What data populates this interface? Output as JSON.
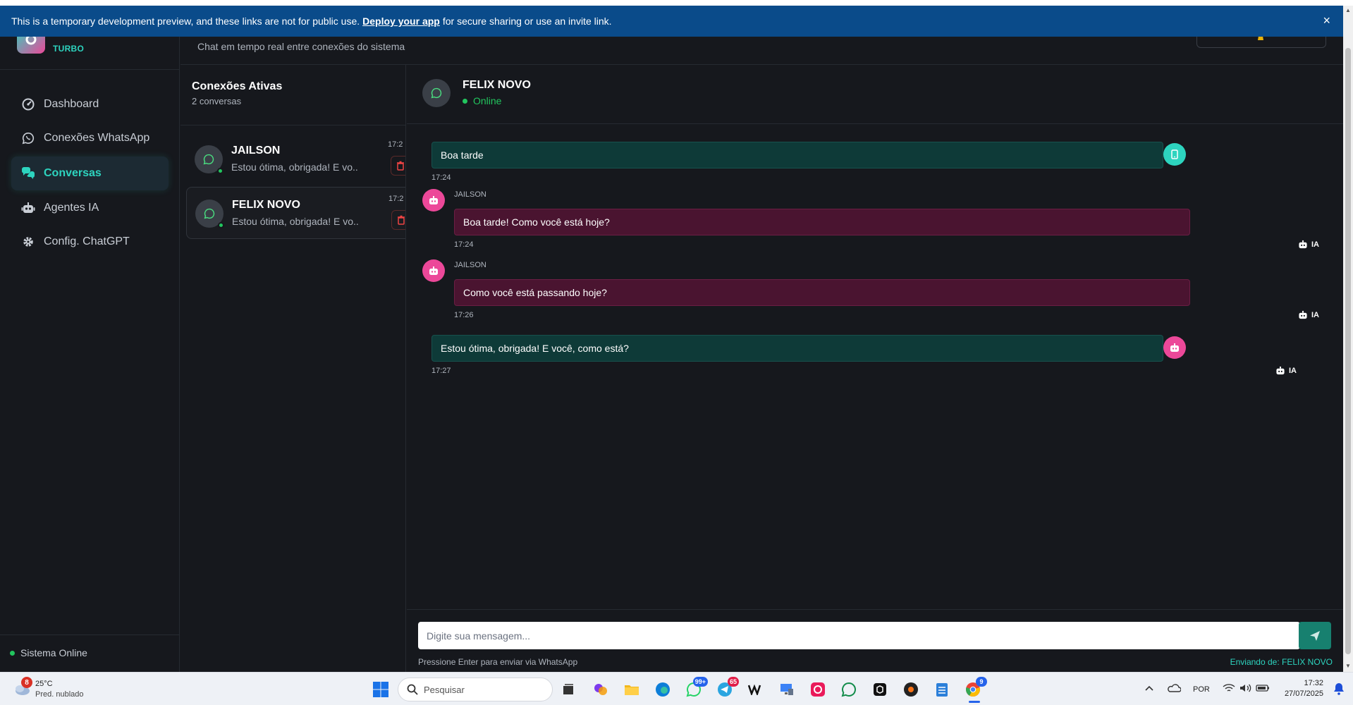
{
  "banner": {
    "text_before": "This is a temporary development preview, and these links are not for public use.",
    "link": "Deploy your app",
    "text_after": "for secure sharing or use an invite link.",
    "close": "×"
  },
  "brand": {
    "subtitle": "TURBO"
  },
  "nav": {
    "items": [
      {
        "label": "Dashboard",
        "icon": "dashboard-icon"
      },
      {
        "label": "Conexões WhatsApp",
        "icon": "whatsapp-icon"
      },
      {
        "label": "Conversas",
        "icon": "chat-icon",
        "active": true
      },
      {
        "label": "Agentes IA",
        "icon": "robot-icon"
      },
      {
        "label": "Config. ChatGPT",
        "icon": "gear-icon"
      }
    ]
  },
  "system_status": "Sistema Online",
  "header": {
    "subtitle": "Chat em tempo real entre conexões do sistema"
  },
  "conversations": {
    "title": "Conexões Ativas",
    "count": "2 conversas",
    "items": [
      {
        "name": "JAILSON",
        "preview": "Estou ótima, obrigada! E vo...",
        "time": "17:2"
      },
      {
        "name": "FELIX NOVO",
        "preview": "Estou ótima, obrigada! E vo...",
        "time": "17:2",
        "selected": true
      }
    ]
  },
  "chat": {
    "contact_name": "FELIX NOVO",
    "status": "Online",
    "messages": [
      {
        "direction": "out",
        "text": "Boa tarde",
        "time": "17:24"
      },
      {
        "direction": "in",
        "sender": "JAILSON",
        "text": "Boa tarde! Como você está hoje?",
        "time": "17:24",
        "badge": "IA"
      },
      {
        "direction": "in",
        "sender": "JAILSON",
        "text": "Como você está passando hoje?",
        "time": "17:26",
        "badge": "IA"
      },
      {
        "direction": "out",
        "text": "Estou ótima, obrigada! E você, como está?",
        "time": "17:27",
        "badge": "IA"
      }
    ],
    "input_placeholder": "Digite sua mensagem...",
    "hint": "Pressione Enter para enviar via WhatsApp",
    "sending_from": "Enviando de: FELIX NOVO"
  },
  "taskbar": {
    "weather_temp": "25°C",
    "weather_desc": "Pred. nublado",
    "weather_badge": "8",
    "search_placeholder": "Pesquisar",
    "whatsapp_badge": "99+",
    "telegram_badge": "65",
    "chrome_badge": "9",
    "language": "POR",
    "time": "17:32",
    "date": "27/07/2025"
  },
  "colors": {
    "accent": "#2dd4bf",
    "incoming": "#4a1430",
    "outgoing": "#0e3a38",
    "online": "#22c55e",
    "banner": "#0a4b8a"
  }
}
